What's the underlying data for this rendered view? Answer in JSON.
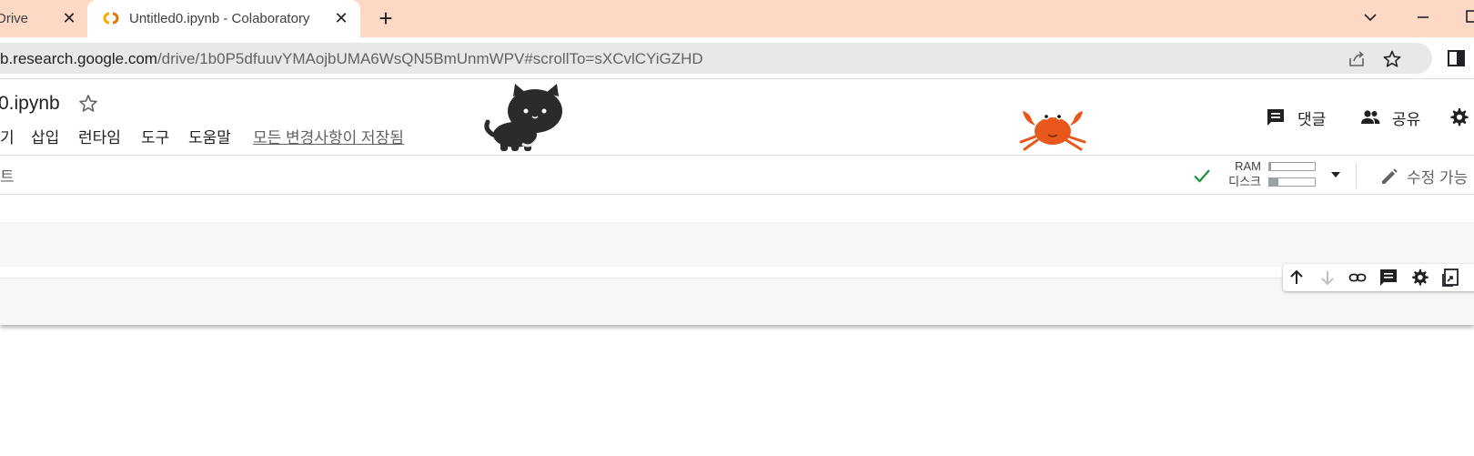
{
  "browser": {
    "tabs": [
      {
        "title": "Drive",
        "active": false
      },
      {
        "title": "Untitled0.ipynb - Colaboratory",
        "active": true
      }
    ],
    "url": {
      "host": "b.research.google.com",
      "path": "/drive/1b0P5dfuuvYMAojbUMA6WsQN5BmUnmWPV#scrollTo=sXCvlCYiGZHD"
    }
  },
  "colab": {
    "notebook_title": "0.ipynb",
    "menu": [
      "기",
      "삽입",
      "런타임",
      "도구",
      "도움말"
    ],
    "saved_status": "모든 변경사항이 저장됨",
    "comment_label": "댓글",
    "share_label": "공유",
    "toolbar_left": "트",
    "resources": {
      "ram_label": "RAM",
      "disk_label": "디스크",
      "ram_fraction": 0.04,
      "disk_fraction": 0.2
    },
    "edit_label": "수정 가능"
  },
  "icons": [
    "colab-logo-icon",
    "close-icon",
    "plus-icon",
    "chevron-down-icon",
    "minimize-icon",
    "share-page-icon",
    "bookmark-star-icon",
    "side-panel-icon",
    "star-icon",
    "comment-icon",
    "people-icon",
    "gear-icon",
    "check-icon",
    "pencil-icon",
    "arrow-up-icon",
    "arrow-down-icon",
    "link-icon",
    "mirror-cell-icon"
  ],
  "colors": {
    "tabstrip": "#fdd9c5",
    "check": "#1e8e3e",
    "crab": "#e8581c"
  }
}
